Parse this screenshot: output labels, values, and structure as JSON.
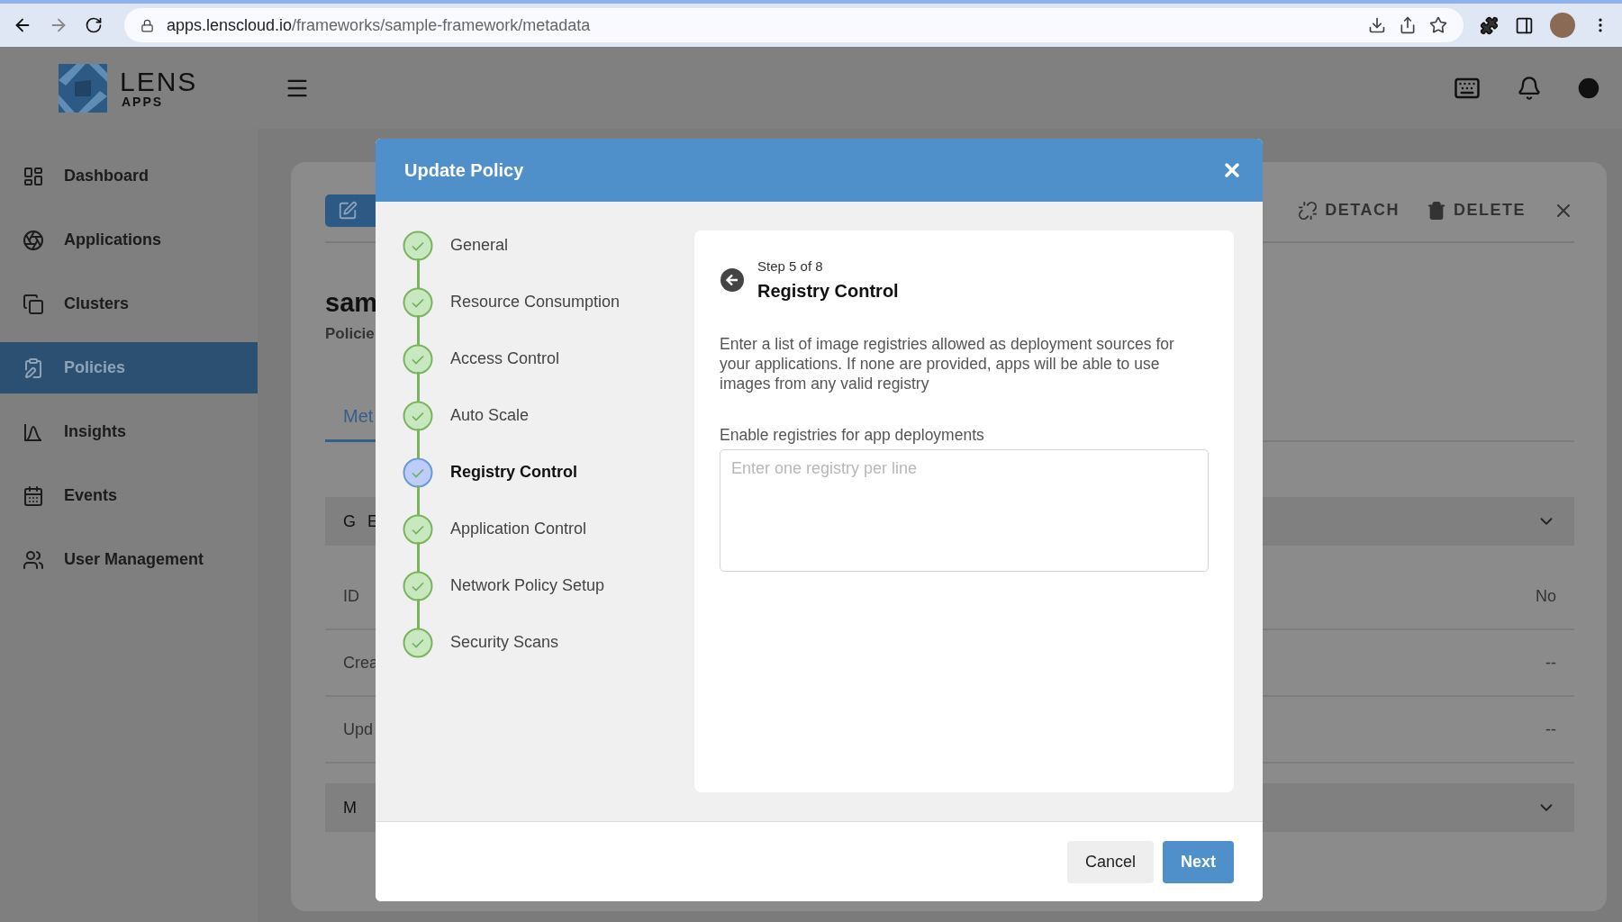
{
  "browser": {
    "url_host": "apps.lenscloud.io",
    "url_path": "/frameworks/sample-framework/metadata"
  },
  "logo": {
    "name": "LENS",
    "sub": "APPS"
  },
  "sidebar": {
    "items": [
      {
        "label": "Dashboard",
        "selected": false
      },
      {
        "label": "Applications",
        "selected": false
      },
      {
        "label": "Clusters",
        "selected": false
      },
      {
        "label": "Policies",
        "selected": true
      },
      {
        "label": "Insights",
        "selected": false
      },
      {
        "label": "Events",
        "selected": false
      },
      {
        "label": "User Management",
        "selected": false
      }
    ]
  },
  "page": {
    "actions": [
      "DETACH",
      "DELETE"
    ],
    "title": "sam",
    "subtitle": "Policie",
    "tabs": [
      {
        "label": "Met",
        "selected": true
      }
    ],
    "sections": [
      {
        "kind": "header",
        "label": "G E"
      },
      {
        "kind": "row",
        "label": "ID",
        "value": "No"
      },
      {
        "kind": "row",
        "label": "Crea",
        "value": "--"
      },
      {
        "kind": "row",
        "label": "Upd",
        "value": "--"
      },
      {
        "kind": "header",
        "label": "M"
      }
    ]
  },
  "dialog": {
    "title": "Update Policy",
    "steps": [
      {
        "label": "General",
        "selected": false
      },
      {
        "label": "Resource Consumption",
        "selected": false
      },
      {
        "label": "Access Control",
        "selected": false
      },
      {
        "label": "Auto Scale",
        "selected": false
      },
      {
        "label": "Registry Control",
        "selected": true
      },
      {
        "label": "Application Control",
        "selected": false
      },
      {
        "label": "Network Policy Setup",
        "selected": false
      },
      {
        "label": "Security Scans",
        "selected": false
      }
    ],
    "step_counter": "Step 5 of 8",
    "heading": "Registry Control",
    "description": "Enter a list of image registries allowed as deployment sources for your applications. If none are provided, apps will be able to use images from any valid registry",
    "field": {
      "label": "Enable registries for app deployments",
      "placeholder": "Enter one registry per line"
    },
    "buttons": [
      {
        "label": "Cancel",
        "kind": "secondary"
      },
      {
        "label": "Next",
        "kind": "primary"
      }
    ]
  }
}
